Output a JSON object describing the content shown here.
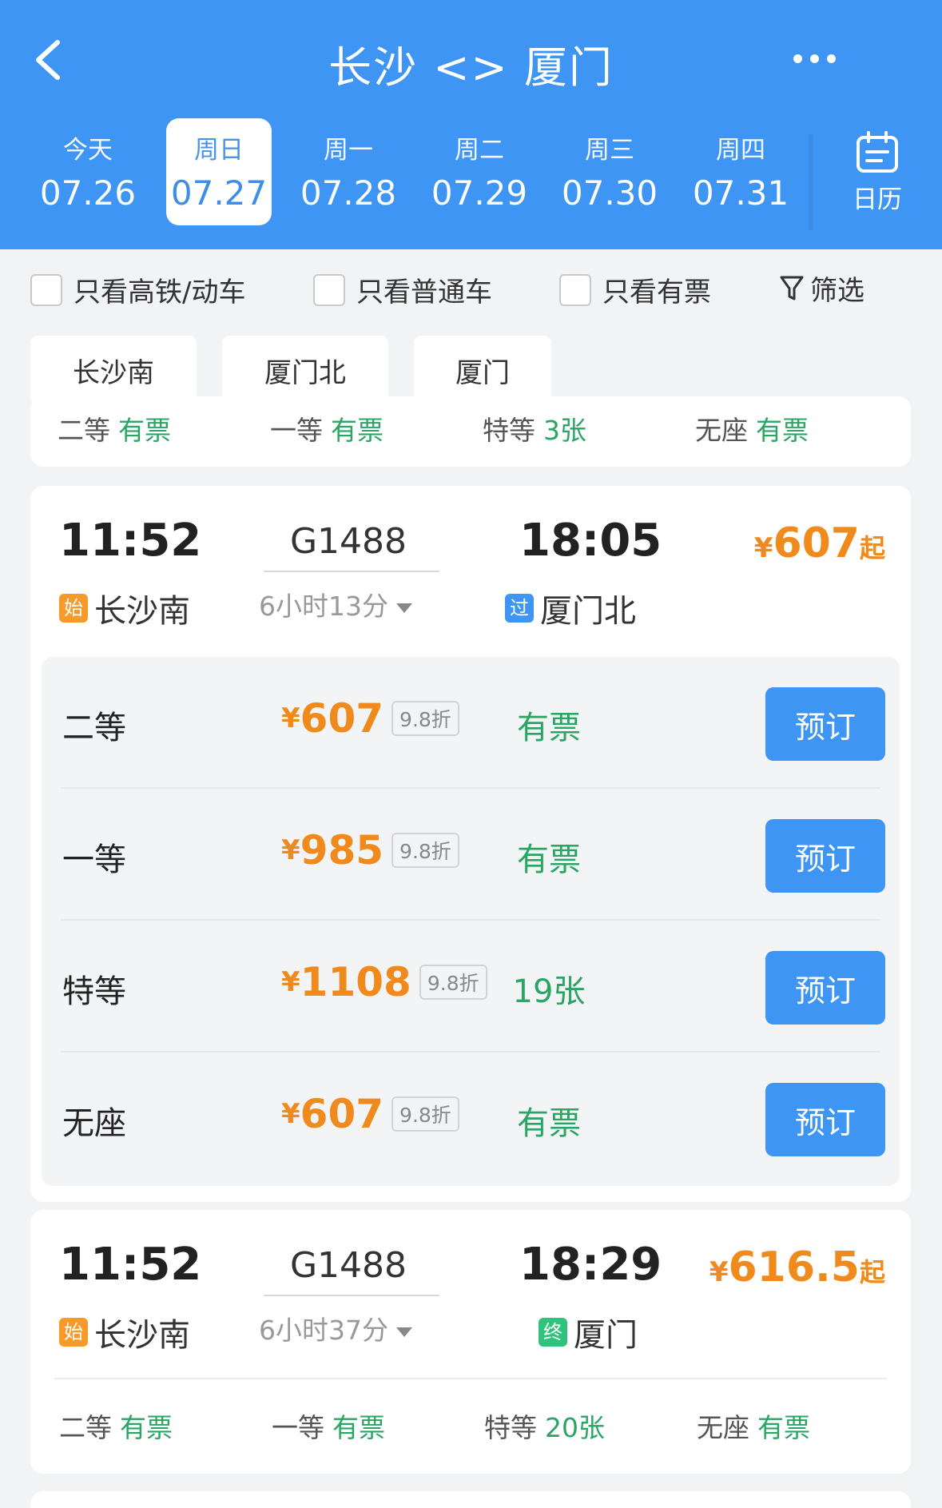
{
  "header": {
    "title": "长沙 <> 厦门",
    "back_icon": "chevron-left-icon",
    "more_icon": "more-horizontal-icon"
  },
  "dates": [
    {
      "weekday": "今天",
      "date": "07.26",
      "active": false
    },
    {
      "weekday": "周日",
      "date": "07.27",
      "active": true
    },
    {
      "weekday": "周一",
      "date": "07.28",
      "active": false
    },
    {
      "weekday": "周二",
      "date": "07.29",
      "active": false
    },
    {
      "weekday": "周三",
      "date": "07.30",
      "active": false
    },
    {
      "weekday": "周四",
      "date": "07.31",
      "active": false
    }
  ],
  "calendar": {
    "label": "日历",
    "icon": "calendar-icon"
  },
  "filters": {
    "high_speed": "只看高铁/动车",
    "normal": "只看普通车",
    "available": "只看有票",
    "filter": "筛选"
  },
  "stations": [
    "长沙南",
    "厦门北",
    "厦门"
  ],
  "partial_card": {
    "seats": [
      {
        "cls": "二等",
        "status": "有票"
      },
      {
        "cls": "一等",
        "status": "有票"
      },
      {
        "cls": "特等",
        "status": "3张"
      },
      {
        "cls": "无座",
        "status": "有票"
      }
    ]
  },
  "train1": {
    "dep_time": "11:52",
    "train_no": "G1488",
    "arr_time": "18:05",
    "duration": "6小时13分",
    "dep_badge": "始",
    "dep_station": "长沙南",
    "arr_badge": "过",
    "arr_station": "厦门北",
    "currency": "¥",
    "price_from": "607",
    "from_suffix": "起",
    "seats": [
      {
        "cls": "二等",
        "price": "607",
        "discount": "9.8折",
        "status": "有票",
        "book": "预订"
      },
      {
        "cls": "一等",
        "price": "985",
        "discount": "9.8折",
        "status": "有票",
        "book": "预订"
      },
      {
        "cls": "特等",
        "price": "1108",
        "discount": "9.8折",
        "status": "19张",
        "book": "预订"
      },
      {
        "cls": "无座",
        "price": "607",
        "discount": "9.8折",
        "status": "有票",
        "book": "预订"
      }
    ]
  },
  "train2": {
    "dep_time": "11:52",
    "train_no": "G1488",
    "arr_time": "18:29",
    "duration": "6小时37分",
    "dep_badge": "始",
    "dep_station": "长沙南",
    "arr_badge": "终",
    "arr_station": "厦门",
    "currency": "¥",
    "price_from": "616.5",
    "from_suffix": "起",
    "seats": [
      {
        "cls": "二等",
        "status": "有票"
      },
      {
        "cls": "一等",
        "status": "有票"
      },
      {
        "cls": "特等",
        "status": "20张"
      },
      {
        "cls": "无座",
        "status": "有票"
      }
    ]
  },
  "colors": {
    "header_blue": "#3e95f3",
    "price_orange": "#f08a1d",
    "available_green": "#2aa563"
  }
}
